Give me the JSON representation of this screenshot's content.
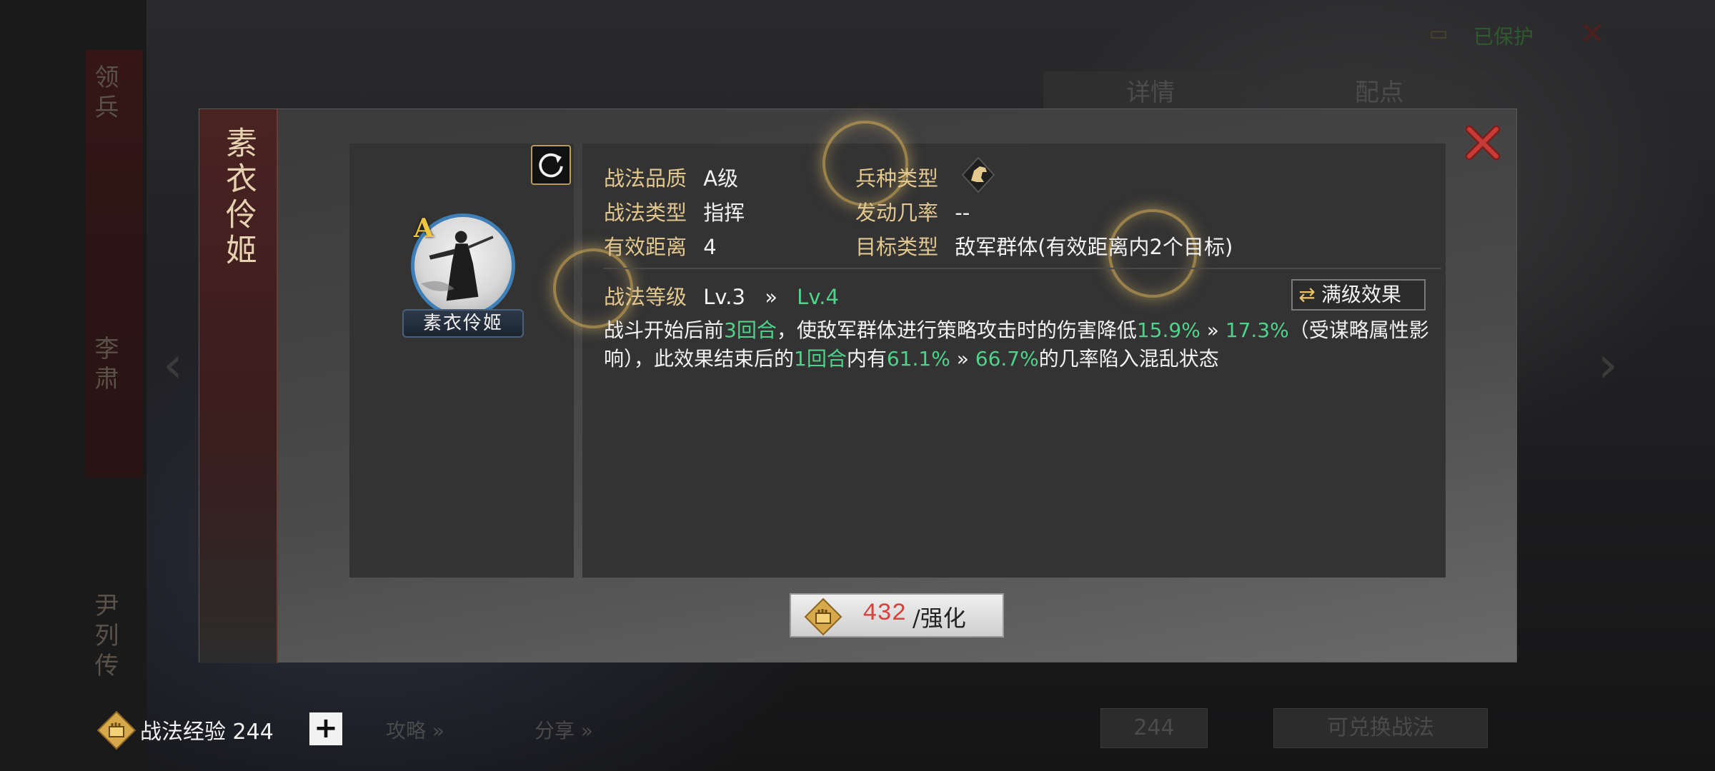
{
  "background": {
    "side_texts": [
      "领兵",
      "李肃",
      "尹列传"
    ],
    "tabs": [
      "详情",
      "配点"
    ],
    "top_right_status": "已保护",
    "right_counter": "244",
    "right_button": "可兑换战法"
  },
  "dialog": {
    "title": "素衣伶姬",
    "portrait": {
      "grade": "A",
      "name": "素衣伶姬"
    },
    "info": {
      "quality_label": "战法品质",
      "quality_value": "A级",
      "type_label": "战法类型",
      "type_value": "指挥",
      "range_label": "有效距离",
      "range_value": "4",
      "troop_label": "兵种类型",
      "troop_icon": "cavalry-horse-icon",
      "rate_label": "发动几率",
      "rate_value": "--",
      "target_label": "目标类型",
      "target_value": "敌军群体(有效距离内2个目标)"
    },
    "level": {
      "label": "战法等级",
      "current": "Lv.3",
      "arrow": "»",
      "next": "Lv.4",
      "max_button": "满级效果"
    },
    "description": {
      "p1": "战斗开始后前",
      "g1": "3回合",
      "p2": "，使敌军群体进行策略攻击时的伤害降低",
      "g2": "15.9%",
      "a1": " » ",
      "g3": "17.3%",
      "p3": "（受谋略属性影响），此效果结束后的",
      "g4": "1回合",
      "p4": "内有",
      "g5": "61.1%",
      "a2": " » ",
      "g6": "66.7%",
      "p5": "的几率陷入混乱状态"
    },
    "enhance": {
      "cost": "432",
      "label": "/强化"
    }
  },
  "bottom": {
    "exp_label": "战法经验 244",
    "add": "+",
    "strategy": "攻略 »",
    "share": "分享 »"
  },
  "colors": {
    "label_gold": "#e2c88f",
    "green": "#4fd38a",
    "cost_red": "#d9413b"
  }
}
